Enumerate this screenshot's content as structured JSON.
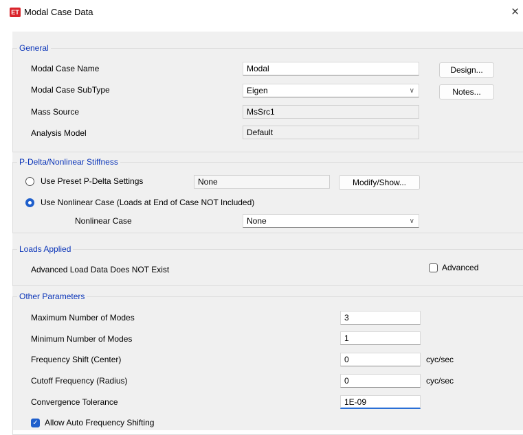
{
  "window": {
    "title": "Modal Case Data",
    "app_icon_text": "ET",
    "close_glyph": "×"
  },
  "general": {
    "section_title": "General",
    "modal_case_name_label": "Modal Case Name",
    "modal_case_name_value": "Modal",
    "subtype_label": "Modal Case SubType",
    "subtype_value": "Eigen",
    "mass_source_label": "Mass Source",
    "mass_source_value": "MsSrc1",
    "analysis_model_label": "Analysis Model",
    "analysis_model_value": "Default",
    "design_button": "Design...",
    "notes_button": "Notes..."
  },
  "pdelta": {
    "section_title": "P-Delta/Nonlinear Stiffness",
    "preset_option_label": "Use Preset P-Delta Settings",
    "preset_value": "None",
    "modify_button": "Modify/Show...",
    "nonlinear_option_label": "Use Nonlinear Case  (Loads at End of Case NOT Included)",
    "nonlinear_case_label": "Nonlinear Case",
    "nonlinear_case_value": "None",
    "selected_option": "nonlinear"
  },
  "loads": {
    "section_title": "Loads Applied",
    "status_text": "Advanced Load Data Does NOT Exist",
    "advanced_label": "Advanced",
    "advanced_checked": false
  },
  "other": {
    "section_title": "Other Parameters",
    "max_modes_label": "Maximum Number of Modes",
    "max_modes_value": "3",
    "min_modes_label": "Minimum Number of Modes",
    "min_modes_value": "1",
    "freq_shift_label": "Frequency Shift  (Center)",
    "freq_shift_value": "0",
    "freq_shift_unit": "cyc/sec",
    "cutoff_label": "Cutoff Frequency  (Radius)",
    "cutoff_value": "0",
    "cutoff_unit": "cyc/sec",
    "tolerance_label": "Convergence Tolerance",
    "tolerance_value": "1E-09",
    "auto_shift_label": "Allow Auto Frequency Shifting",
    "auto_shift_checked": true
  },
  "colors": {
    "section_title": "#0a34b8",
    "accent": "#1f5fcc",
    "app_icon": "#d9242b"
  },
  "icons": {
    "chevron": "chevron-down-icon",
    "checkmark": "checkmark-icon",
    "close": "close-icon"
  }
}
